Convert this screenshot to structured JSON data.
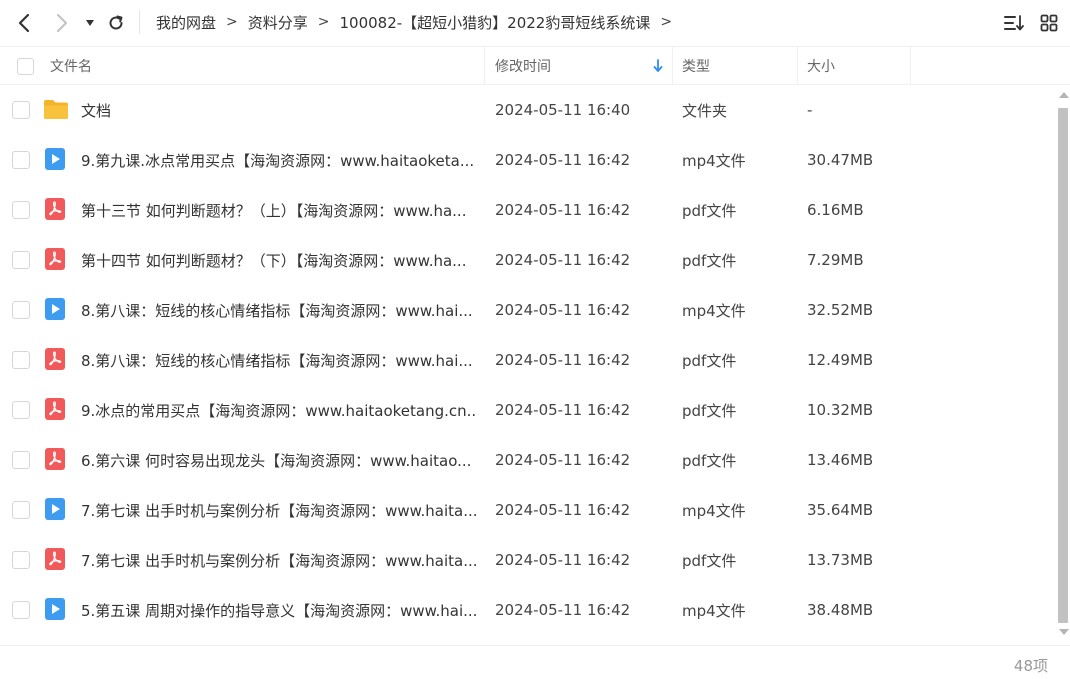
{
  "toolbar": {
    "breadcrumb": [
      "我的网盘",
      "资料分享",
      "100082-【超短小猎豹】2022豹哥短线系统课"
    ],
    "separator": ">"
  },
  "columns": {
    "name": "文件名",
    "time": "修改时间",
    "type": "类型",
    "size": "大小"
  },
  "files": [
    {
      "name": "文档",
      "time": "2024-05-11 16:40",
      "type": "文件夹",
      "size": "-",
      "icon": "folder-icon"
    },
    {
      "name": "9.第九课.冰点常用买点【海淘资源网：www.haitaoketa...",
      "time": "2024-05-11 16:42",
      "type": "mp4文件",
      "size": "30.47MB",
      "icon": "video-file-icon"
    },
    {
      "name": "第十三节 如何判断题材？（上）【海淘资源网：www.ha...",
      "time": "2024-05-11 16:42",
      "type": "pdf文件",
      "size": "6.16MB",
      "icon": "pdf-file-icon"
    },
    {
      "name": "第十四节 如何判断题材？（下）【海淘资源网：www.ha...",
      "time": "2024-05-11 16:42",
      "type": "pdf文件",
      "size": "7.29MB",
      "icon": "pdf-file-icon"
    },
    {
      "name": "8.第八课：短线的核心情绪指标【海淘资源网：www.hai...",
      "time": "2024-05-11 16:42",
      "type": "mp4文件",
      "size": "32.52MB",
      "icon": "video-file-icon"
    },
    {
      "name": "8.第八课：短线的核心情绪指标【海淘资源网：www.hai...",
      "time": "2024-05-11 16:42",
      "type": "pdf文件",
      "size": "12.49MB",
      "icon": "pdf-file-icon"
    },
    {
      "name": "9.冰点的常用买点【海淘资源网：www.haitaoketang.cn...",
      "time": "2024-05-11 16:42",
      "type": "pdf文件",
      "size": "10.32MB",
      "icon": "pdf-file-icon"
    },
    {
      "name": "6.第六课 何时容易出现龙头【海淘资源网：www.haitao...",
      "time": "2024-05-11 16:42",
      "type": "pdf文件",
      "size": "13.46MB",
      "icon": "pdf-file-icon"
    },
    {
      "name": "7.第七课 出手时机与案例分析【海淘资源网：www.haita...",
      "time": "2024-05-11 16:42",
      "type": "mp4文件",
      "size": "35.64MB",
      "icon": "video-file-icon"
    },
    {
      "name": "7.第七课 出手时机与案例分析【海淘资源网：www.haita...",
      "time": "2024-05-11 16:42",
      "type": "pdf文件",
      "size": "13.73MB",
      "icon": "pdf-file-icon"
    },
    {
      "name": "5.第五课 周期对操作的指导意义【海淘资源网：www.hai...",
      "time": "2024-05-11 16:42",
      "type": "mp4文件",
      "size": "38.48MB",
      "icon": "video-file-icon"
    }
  ],
  "footer": {
    "count": "48项"
  },
  "colors": {
    "folder": "#f9c23c",
    "video": "#3d9bf0",
    "pdf": "#f05a5a",
    "sort_arrow": "#2f8cf0"
  }
}
